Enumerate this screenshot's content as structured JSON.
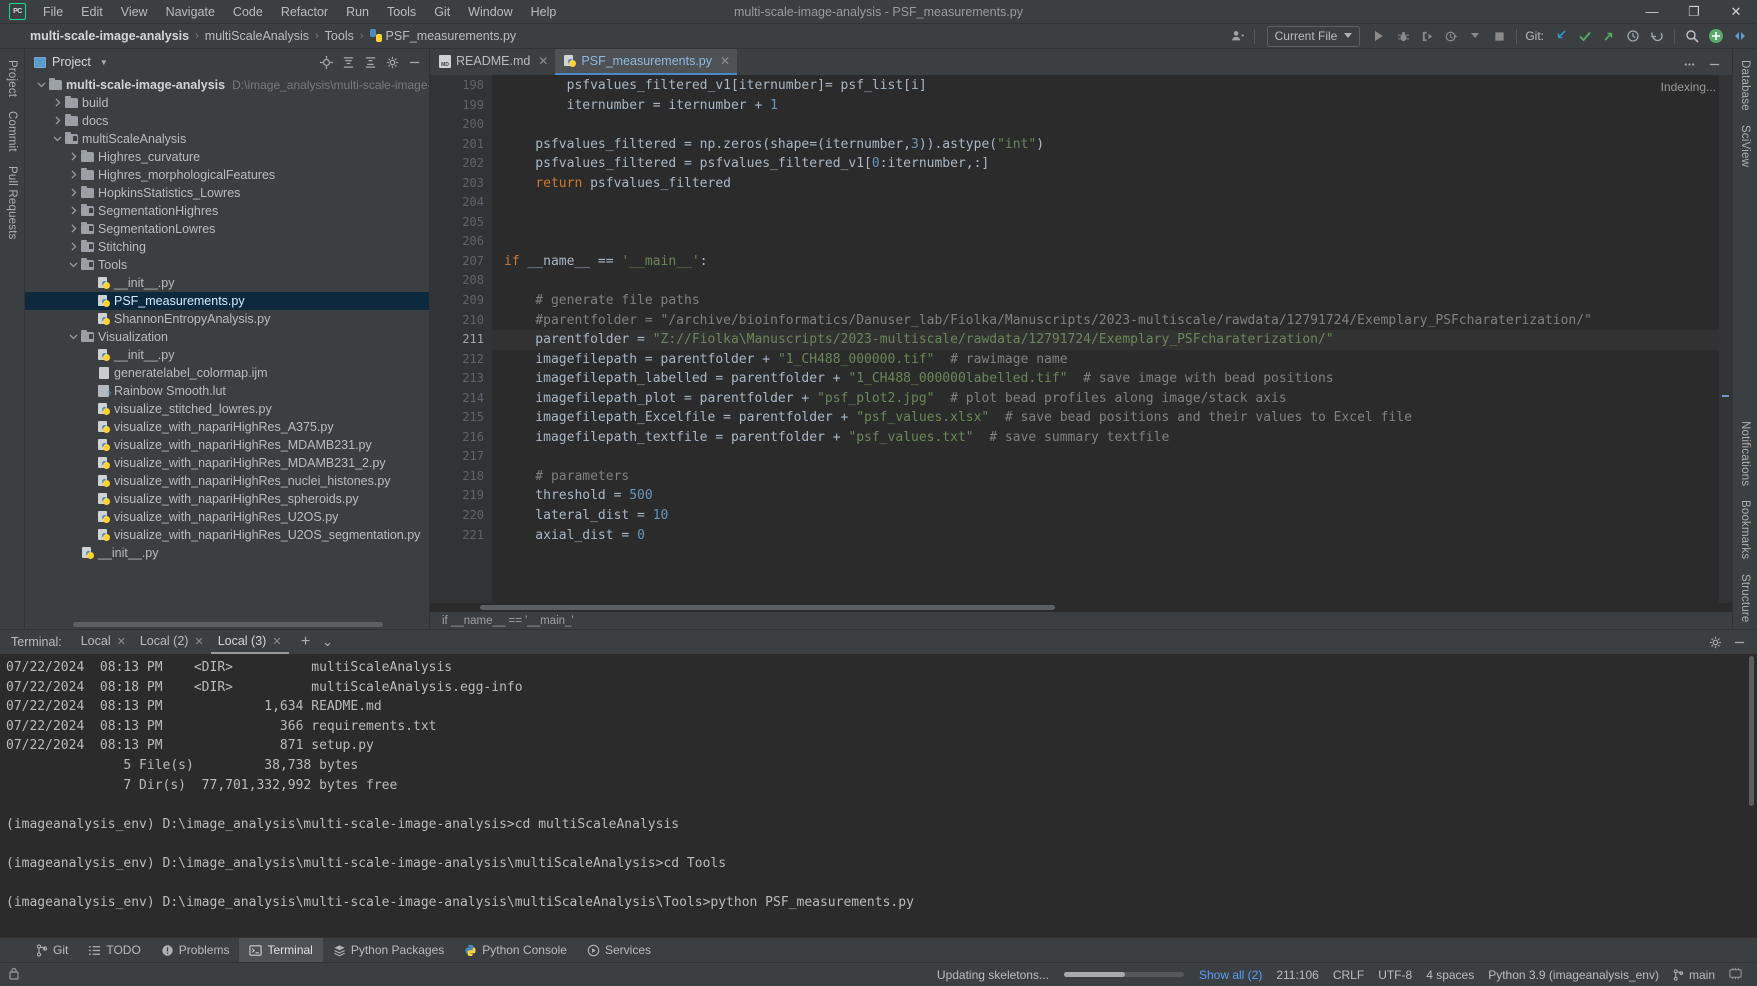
{
  "window": {
    "title": "multi-scale-image-analysis - PSF_measurements.py",
    "logo": "pycharm-logo",
    "minimize": "—",
    "maximize": "❐",
    "close": "✕"
  },
  "menu": [
    "File",
    "Edit",
    "View",
    "Navigate",
    "Code",
    "Refactor",
    "Run",
    "Tools",
    "Git",
    "Window",
    "Help"
  ],
  "breadcrumbs": [
    {
      "label": "multi-scale-image-analysis",
      "bold": true
    },
    {
      "label": "multiScaleAnalysis",
      "bold": false
    },
    {
      "label": "Tools",
      "bold": false
    },
    {
      "label": "PSF_measurements.py",
      "bold": false,
      "icon": "python-file-icon"
    }
  ],
  "toolbar": {
    "run_config": "Current File",
    "git_label": "Git:",
    "icons": [
      "run-icon",
      "debug-icon",
      "run-coverage-icon",
      "profile-icon",
      "stop-icon",
      "update-project-icon",
      "commit-icon",
      "push-icon",
      "history-icon",
      "rollback-icon",
      "search-everywhere-icon",
      "settings-icon",
      "hide-icon"
    ]
  },
  "left_strip": [
    "Project",
    "Commit",
    "Pull Requests"
  ],
  "right_strip": [
    "Database",
    "SciView",
    "Notifications",
    "Bookmarks",
    "Structure"
  ],
  "project_panel": {
    "title": "Project",
    "header_icons": [
      "locate-icon",
      "expand-all-icon",
      "collapse-all-icon",
      "settings-icon",
      "hide-icon"
    ],
    "tree": [
      {
        "depth": 0,
        "twisty": "⌄",
        "icon": "folder-icon",
        "label": "multi-scale-image-analysis",
        "bold": true,
        "path": "D:\\image_analysis\\multi-scale-image-analysis",
        "selected": false
      },
      {
        "depth": 1,
        "twisty": "›",
        "icon": "folder-icon",
        "label": "build",
        "bold": false,
        "selected": false
      },
      {
        "depth": 1,
        "twisty": "›",
        "icon": "folder-icon",
        "label": "docs",
        "bold": false,
        "selected": false
      },
      {
        "depth": 1,
        "twisty": "⌄",
        "icon": "folder-module-icon",
        "label": "multiScaleAnalysis",
        "bold": false,
        "selected": false
      },
      {
        "depth": 2,
        "twisty": "›",
        "icon": "folder-icon",
        "label": "Highres_curvature",
        "bold": false,
        "selected": false
      },
      {
        "depth": 2,
        "twisty": "›",
        "icon": "folder-icon",
        "label": "Highres_morphologicalFeatures",
        "bold": false,
        "selected": false
      },
      {
        "depth": 2,
        "twisty": "›",
        "icon": "folder-icon",
        "label": "HopkinsStatistics_Lowres",
        "bold": false,
        "selected": false
      },
      {
        "depth": 2,
        "twisty": "›",
        "icon": "folder-module-icon",
        "label": "SegmentationHighres",
        "bold": false,
        "selected": false
      },
      {
        "depth": 2,
        "twisty": "›",
        "icon": "folder-module-icon",
        "label": "SegmentationLowres",
        "bold": false,
        "selected": false
      },
      {
        "depth": 2,
        "twisty": "›",
        "icon": "folder-module-icon",
        "label": "Stitching",
        "bold": false,
        "selected": false
      },
      {
        "depth": 2,
        "twisty": "⌄",
        "icon": "folder-module-icon",
        "label": "Tools",
        "bold": false,
        "selected": false
      },
      {
        "depth": 3,
        "twisty": "",
        "icon": "python-file-icon",
        "label": "__init__.py",
        "bold": false,
        "selected": false
      },
      {
        "depth": 3,
        "twisty": "",
        "icon": "python-file-icon",
        "label": "PSF_measurements.py",
        "bold": false,
        "selected": true
      },
      {
        "depth": 3,
        "twisty": "",
        "icon": "python-file-icon",
        "label": "ShannonEntropyAnalysis.py",
        "bold": false,
        "selected": false
      },
      {
        "depth": 2,
        "twisty": "⌄",
        "icon": "folder-module-icon",
        "label": "Visualization",
        "bold": false,
        "selected": false
      },
      {
        "depth": 3,
        "twisty": "",
        "icon": "python-file-icon",
        "label": "__init__.py",
        "bold": false,
        "selected": false
      },
      {
        "depth": 3,
        "twisty": "",
        "icon": "text-file-icon",
        "label": "generatelabel_colormap.ijm",
        "bold": false,
        "selected": false
      },
      {
        "depth": 3,
        "twisty": "",
        "icon": "lut-file-icon",
        "label": "Rainbow Smooth.lut",
        "bold": false,
        "selected": false
      },
      {
        "depth": 3,
        "twisty": "",
        "icon": "python-file-icon",
        "label": "visualize_stitched_lowres.py",
        "bold": false,
        "selected": false
      },
      {
        "depth": 3,
        "twisty": "",
        "icon": "python-file-icon",
        "label": "visualize_with_napariHighRes_A375.py",
        "bold": false,
        "selected": false
      },
      {
        "depth": 3,
        "twisty": "",
        "icon": "python-file-icon",
        "label": "visualize_with_napariHighRes_MDAMB231.py",
        "bold": false,
        "selected": false
      },
      {
        "depth": 3,
        "twisty": "",
        "icon": "python-file-icon",
        "label": "visualize_with_napariHighRes_MDAMB231_2.py",
        "bold": false,
        "selected": false
      },
      {
        "depth": 3,
        "twisty": "",
        "icon": "python-file-icon",
        "label": "visualize_with_napariHighRes_nuclei_histones.py",
        "bold": false,
        "selected": false
      },
      {
        "depth": 3,
        "twisty": "",
        "icon": "python-file-icon",
        "label": "visualize_with_napariHighRes_spheroids.py",
        "bold": false,
        "selected": false
      },
      {
        "depth": 3,
        "twisty": "",
        "icon": "python-file-icon",
        "label": "visualize_with_napariHighRes_U2OS.py",
        "bold": false,
        "selected": false
      },
      {
        "depth": 3,
        "twisty": "",
        "icon": "python-file-icon",
        "label": "visualize_with_napariHighRes_U2OS_segmentation.py",
        "bold": false,
        "selected": false
      },
      {
        "depth": 2,
        "twisty": "",
        "icon": "python-file-icon",
        "label": "__init__.py",
        "bold": false,
        "selected": false
      }
    ]
  },
  "editor": {
    "tabs": [
      {
        "label": "README.md",
        "icon": "markdown-file-icon",
        "active": false
      },
      {
        "label": "PSF_measurements.py",
        "icon": "python-file-icon",
        "active": true
      }
    ],
    "indexing_status": "Indexing...",
    "bottom_breadcrumb": "if __name__ == '__main_'",
    "first_line_number": 198,
    "current_line": 211,
    "lines": [
      {
        "n": 198,
        "fold": "",
        "tokens": [
          {
            "t": "        psfvalues_filtered_v1[iternumber]= psf_list[i]",
            "c": "p"
          }
        ]
      },
      {
        "n": 199,
        "fold": "⌐",
        "tokens": [
          {
            "t": "        iternumber = iternumber + ",
            "c": "p"
          },
          {
            "t": "1",
            "c": "n"
          }
        ]
      },
      {
        "n": 200,
        "fold": "",
        "tokens": []
      },
      {
        "n": 201,
        "fold": "",
        "tokens": [
          {
            "t": "    psfvalues_filtered = np.zeros(shape=(iternumber,",
            "c": "p"
          },
          {
            "t": "3",
            "c": "n"
          },
          {
            "t": ")).astype(",
            "c": "p"
          },
          {
            "t": "\"int\"",
            "c": "s"
          },
          {
            "t": ")",
            "c": "p"
          }
        ]
      },
      {
        "n": 202,
        "fold": "",
        "tokens": [
          {
            "t": "    psfvalues_filtered = psfvalues_filtered_v1[",
            "c": "p"
          },
          {
            "t": "0",
            "c": "n"
          },
          {
            "t": ":iternumber,:]",
            "c": "p"
          }
        ]
      },
      {
        "n": 203,
        "fold": "⌐",
        "tokens": [
          {
            "t": "    ",
            "c": "p"
          },
          {
            "t": "return",
            "c": "k"
          },
          {
            "t": " psfvalues_filtered",
            "c": "p"
          }
        ]
      },
      {
        "n": 204,
        "fold": "",
        "tokens": []
      },
      {
        "n": 205,
        "fold": "",
        "tokens": []
      },
      {
        "n": 206,
        "fold": "",
        "tokens": []
      },
      {
        "n": 207,
        "fold": "∇",
        "tokens": [
          {
            "t": "if",
            "c": "k"
          },
          {
            "t": " __name__ == ",
            "c": "p"
          },
          {
            "t": "'__main__'",
            "c": "s"
          },
          {
            "t": ":",
            "c": "p"
          }
        ]
      },
      {
        "n": 208,
        "fold": "",
        "tokens": []
      },
      {
        "n": 209,
        "fold": "⌐",
        "tokens": [
          {
            "t": "    # generate file paths",
            "c": "c"
          }
        ]
      },
      {
        "n": 210,
        "fold": "⌐",
        "tokens": [
          {
            "t": "    #parentfolder = \"/archive/bioinformatics/Danuser_lab/Fiolka/Manuscripts/2023-multiscale/rawdata/12791724/Exemplary_PSFcharaterization/\"",
            "c": "c"
          }
        ]
      },
      {
        "n": 211,
        "fold": "",
        "current": true,
        "tokens": [
          {
            "t": "    parentfolder = ",
            "c": "p"
          },
          {
            "t": "\"Z://Fiolka\\Manuscripts/2023-multiscale/rawdata/12791724/Exemplary_PSFcharaterization/\"",
            "c": "s"
          }
        ]
      },
      {
        "n": 212,
        "fold": "",
        "tokens": [
          {
            "t": "    imagefilepath = parentfolder + ",
            "c": "p"
          },
          {
            "t": "\"1_CH488_000000.tif\"",
            "c": "s"
          },
          {
            "t": "  # rawimage name",
            "c": "c"
          }
        ]
      },
      {
        "n": 213,
        "fold": "",
        "tokens": [
          {
            "t": "    imagefilepath_labelled = parentfolder + ",
            "c": "p"
          },
          {
            "t": "\"1_CH488_000000labelled.tif\"",
            "c": "s"
          },
          {
            "t": "  # save image with bead positions",
            "c": "c"
          }
        ]
      },
      {
        "n": 214,
        "fold": "",
        "tokens": [
          {
            "t": "    imagefilepath_plot = parentfolder + ",
            "c": "p"
          },
          {
            "t": "\"psf_plot2.jpg\"",
            "c": "s"
          },
          {
            "t": "  # plot bead profiles along image/stack axis",
            "c": "c"
          }
        ]
      },
      {
        "n": 215,
        "fold": "",
        "tokens": [
          {
            "t": "    imagefilepath_Excelfile = parentfolder + ",
            "c": "p"
          },
          {
            "t": "\"psf_values.xlsx\"",
            "c": "s"
          },
          {
            "t": "  # save bead positions and their values to Excel file",
            "c": "c"
          }
        ]
      },
      {
        "n": 216,
        "fold": "",
        "tokens": [
          {
            "t": "    imagefilepath_textfile = parentfolder + ",
            "c": "p"
          },
          {
            "t": "\"psf_values.txt\"",
            "c": "s"
          },
          {
            "t": "  # save summary textfile",
            "c": "c"
          }
        ]
      },
      {
        "n": 217,
        "fold": "",
        "tokens": []
      },
      {
        "n": 218,
        "fold": "",
        "tokens": [
          {
            "t": "    # parameters",
            "c": "c"
          }
        ]
      },
      {
        "n": 219,
        "fold": "",
        "tokens": [
          {
            "t": "    threshold = ",
            "c": "p"
          },
          {
            "t": "500",
            "c": "n"
          }
        ]
      },
      {
        "n": 220,
        "fold": "",
        "tokens": [
          {
            "t": "    lateral_dist = ",
            "c": "p"
          },
          {
            "t": "10",
            "c": "n"
          }
        ]
      },
      {
        "n": 221,
        "fold": "",
        "tokens": [
          {
            "t": "    axial_dist = ",
            "c": "p"
          },
          {
            "t": "0",
            "c": "n"
          }
        ]
      }
    ]
  },
  "terminal": {
    "label": "Terminal:",
    "tabs": [
      {
        "label": "Local",
        "active": false
      },
      {
        "label": "Local (2)",
        "active": false
      },
      {
        "label": "Local (3)",
        "active": true
      }
    ],
    "add_button": "+",
    "dropdown_button": "⌄",
    "settings_icon": "gear-icon",
    "hide_icon": "hide-icon",
    "output": [
      "07/22/2024  08:13 PM    <DIR>          multiScaleAnalysis",
      "07/22/2024  08:18 PM    <DIR>          multiScaleAnalysis.egg-info",
      "07/22/2024  08:13 PM             1,634 README.md",
      "07/22/2024  08:13 PM               366 requirements.txt",
      "07/22/2024  08:13 PM               871 setup.py",
      "               5 File(s)         38,738 bytes",
      "               7 Dir(s)  77,701,332,992 bytes free",
      "",
      "(imageanalysis_env) D:\\image_analysis\\multi-scale-image-analysis>cd multiScaleAnalysis",
      "",
      "(imageanalysis_env) D:\\image_analysis\\multi-scale-image-analysis\\multiScaleAnalysis>cd Tools",
      "",
      "(imageanalysis_env) D:\\image_analysis\\multi-scale-image-analysis\\multiScaleAnalysis\\Tools>python PSF_measurements.py"
    ]
  },
  "tool_tabs": [
    {
      "label": "Git",
      "icon": "git-branch-icon",
      "active": false
    },
    {
      "label": "TODO",
      "icon": "todo-icon",
      "active": false
    },
    {
      "label": "Problems",
      "icon": "problems-icon",
      "active": false
    },
    {
      "label": "Terminal",
      "icon": "terminal-icon",
      "active": true
    },
    {
      "label": "Python Packages",
      "icon": "packages-icon",
      "active": false
    },
    {
      "label": "Python Console",
      "icon": "python-icon",
      "active": false
    },
    {
      "label": "Services",
      "icon": "services-icon",
      "active": false
    }
  ],
  "status_bar": {
    "progress_text": "Updating skeletons...",
    "show_all": "Show all (2)",
    "caret_position": "211:106",
    "line_separator": "CRLF",
    "encoding": "UTF-8",
    "indent": "4 spaces",
    "interpreter": "Python 3.9 (imageanalysis_env)",
    "branch": "main",
    "lock_icon": "lock-icon"
  },
  "colors": {
    "accent_blue": "#4a88c7",
    "selection": "#0d293e",
    "string_green": "#6a8759",
    "keyword_orange": "#cc7832",
    "number_blue": "#6897bb",
    "comment_gray": "#808080",
    "link_blue": "#589df6",
    "bg_panel": "#3c3f41",
    "bg_editor": "#2b2b2b"
  }
}
